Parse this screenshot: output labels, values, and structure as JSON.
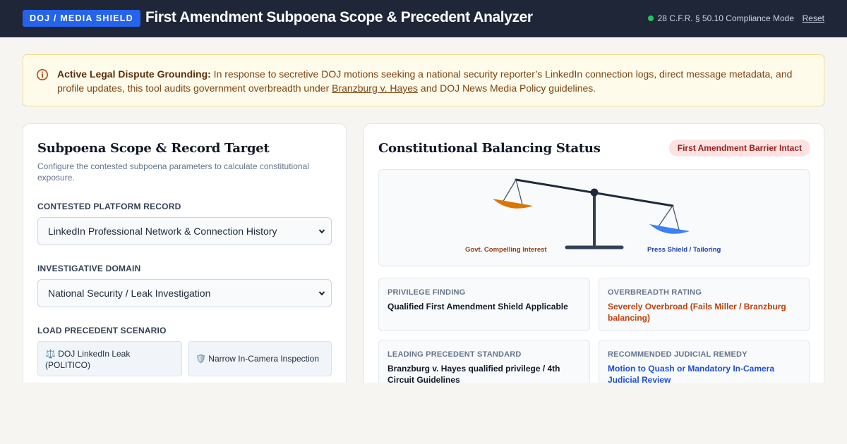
{
  "header": {
    "badge": "DOJ / MEDIA SHIELD",
    "title": "First Amendment Subpoena Scope & Precedent Analyzer",
    "status": "28 C.F.R. § 50.10 Compliance Mode",
    "reset": "Reset"
  },
  "alert": {
    "icon": "info-icon",
    "lead": "Active Legal Dispute Grounding:",
    "text_before": " In response to secretive DOJ motions seeking a national security reporter’s LinkedIn connection logs, direct message metadata, and profile updates, this tool audits government overbreadth under ",
    "link": "Branzburg v. Hayes",
    "text_after": " and DOJ News Media Policy guidelines."
  },
  "left": {
    "title": "Subpoena Scope & Record Target",
    "subtitle": "Configure the contested subpoena parameters to calculate constitutional exposure.",
    "record_label": "Contested Platform Record",
    "record_value": "LinkedIn Professional Network & Connection History",
    "domain_label": "Investigative Domain",
    "domain_value": "National Security / Leak Investigation",
    "scenario_label": "Load Precedent Scenario",
    "presets": [
      {
        "icon": "⚖️",
        "label": "DOJ LinkedIn Leak (POLITICO)"
      },
      {
        "icon": "🛡️",
        "label": "Narrow In-Camera Inspection"
      }
    ]
  },
  "right": {
    "title": "Constitutional Balancing Status",
    "status_pill": "First Amendment Barrier Intact",
    "scale": {
      "left_label": "Govt. Compelling Interest",
      "right_label": "Press Shield / Tailoring",
      "left_color": "#d97706",
      "right_color": "#3b82f6"
    },
    "metrics": [
      {
        "label": "Privilege Finding",
        "value": "Qualified First Amendment Shield Applicable"
      },
      {
        "label": "Overbreadth Rating",
        "value": "Severely Overbroad (Fails Miller / Branzburg balancing)"
      },
      {
        "label": "Leading Precedent Standard",
        "value": "Branzburg v. Hayes qualified privilege / 4th Circuit Guidelines"
      },
      {
        "label": "Recommended Judicial Remedy",
        "value": "Motion to Quash or Mandatory In-Camera Judicial Review"
      }
    ]
  }
}
